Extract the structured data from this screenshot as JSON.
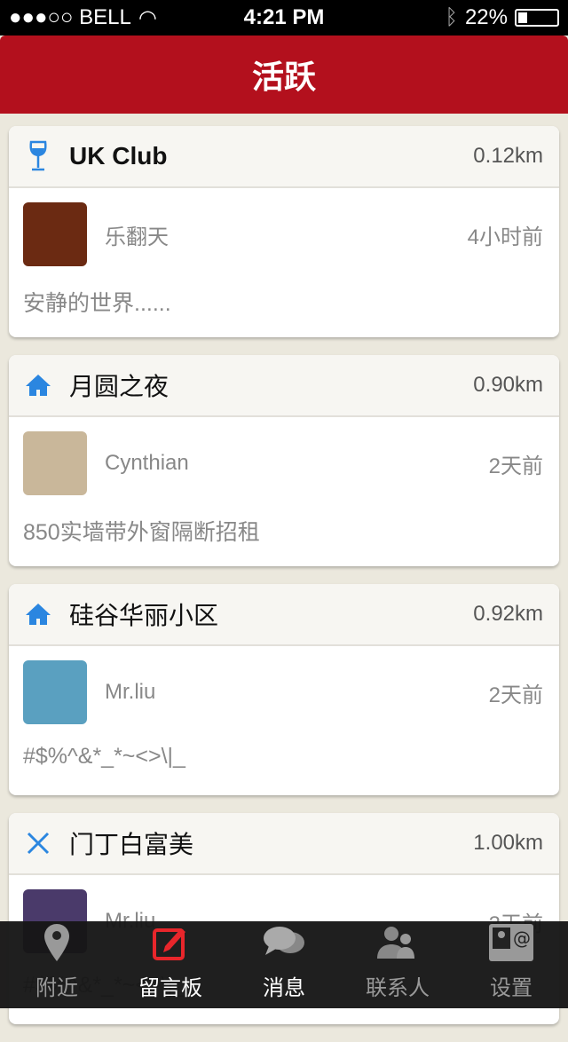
{
  "status": {
    "carrier": "●●●○○ BELL",
    "time": "4:21 PM",
    "battery": "22%",
    "battery_level": 0.22
  },
  "nav": {
    "title": "活跃"
  },
  "cards": [
    {
      "icon": "wine-glass-icon",
      "title": "UK Club",
      "distance": "0.12km",
      "user": "乐翻天",
      "time": "4小时前",
      "message": "安静的世界......",
      "avatar_color": "#6b2a12"
    },
    {
      "icon": "house-icon",
      "title": "月圆之夜",
      "distance": "0.90km",
      "user": "Cynthian",
      "time": "2天前",
      "message": "850实墙带外窗隔断招租",
      "avatar_color": "#c9b79a"
    },
    {
      "icon": "house-icon",
      "title": "硅谷华丽小区",
      "distance": "0.92km",
      "user": "Mr.liu",
      "time": "2天前",
      "message": "#$%^&*_*~<>\\|_",
      "avatar_color": "#5aa0c0"
    },
    {
      "icon": "fork-knife-icon",
      "title": "门丁白富美",
      "distance": "1.00km",
      "user": "Mr.liu",
      "time": "3天前",
      "message": "#$%^&*_*~<>\\|_",
      "avatar_color": "#4a3a6a"
    }
  ],
  "tabs": [
    {
      "label": "附近",
      "icon": "location-pin-icon"
    },
    {
      "label": "留言板",
      "icon": "edit-icon"
    },
    {
      "label": "消息",
      "icon": "chat-bubbles-icon"
    },
    {
      "label": "联系人",
      "icon": "contacts-icon"
    },
    {
      "label": "设置",
      "icon": "contact-card-icon"
    }
  ],
  "colors": {
    "brand": "#b3101d",
    "icon_blue": "#2b86e0",
    "active_tab": "#e8262b"
  }
}
